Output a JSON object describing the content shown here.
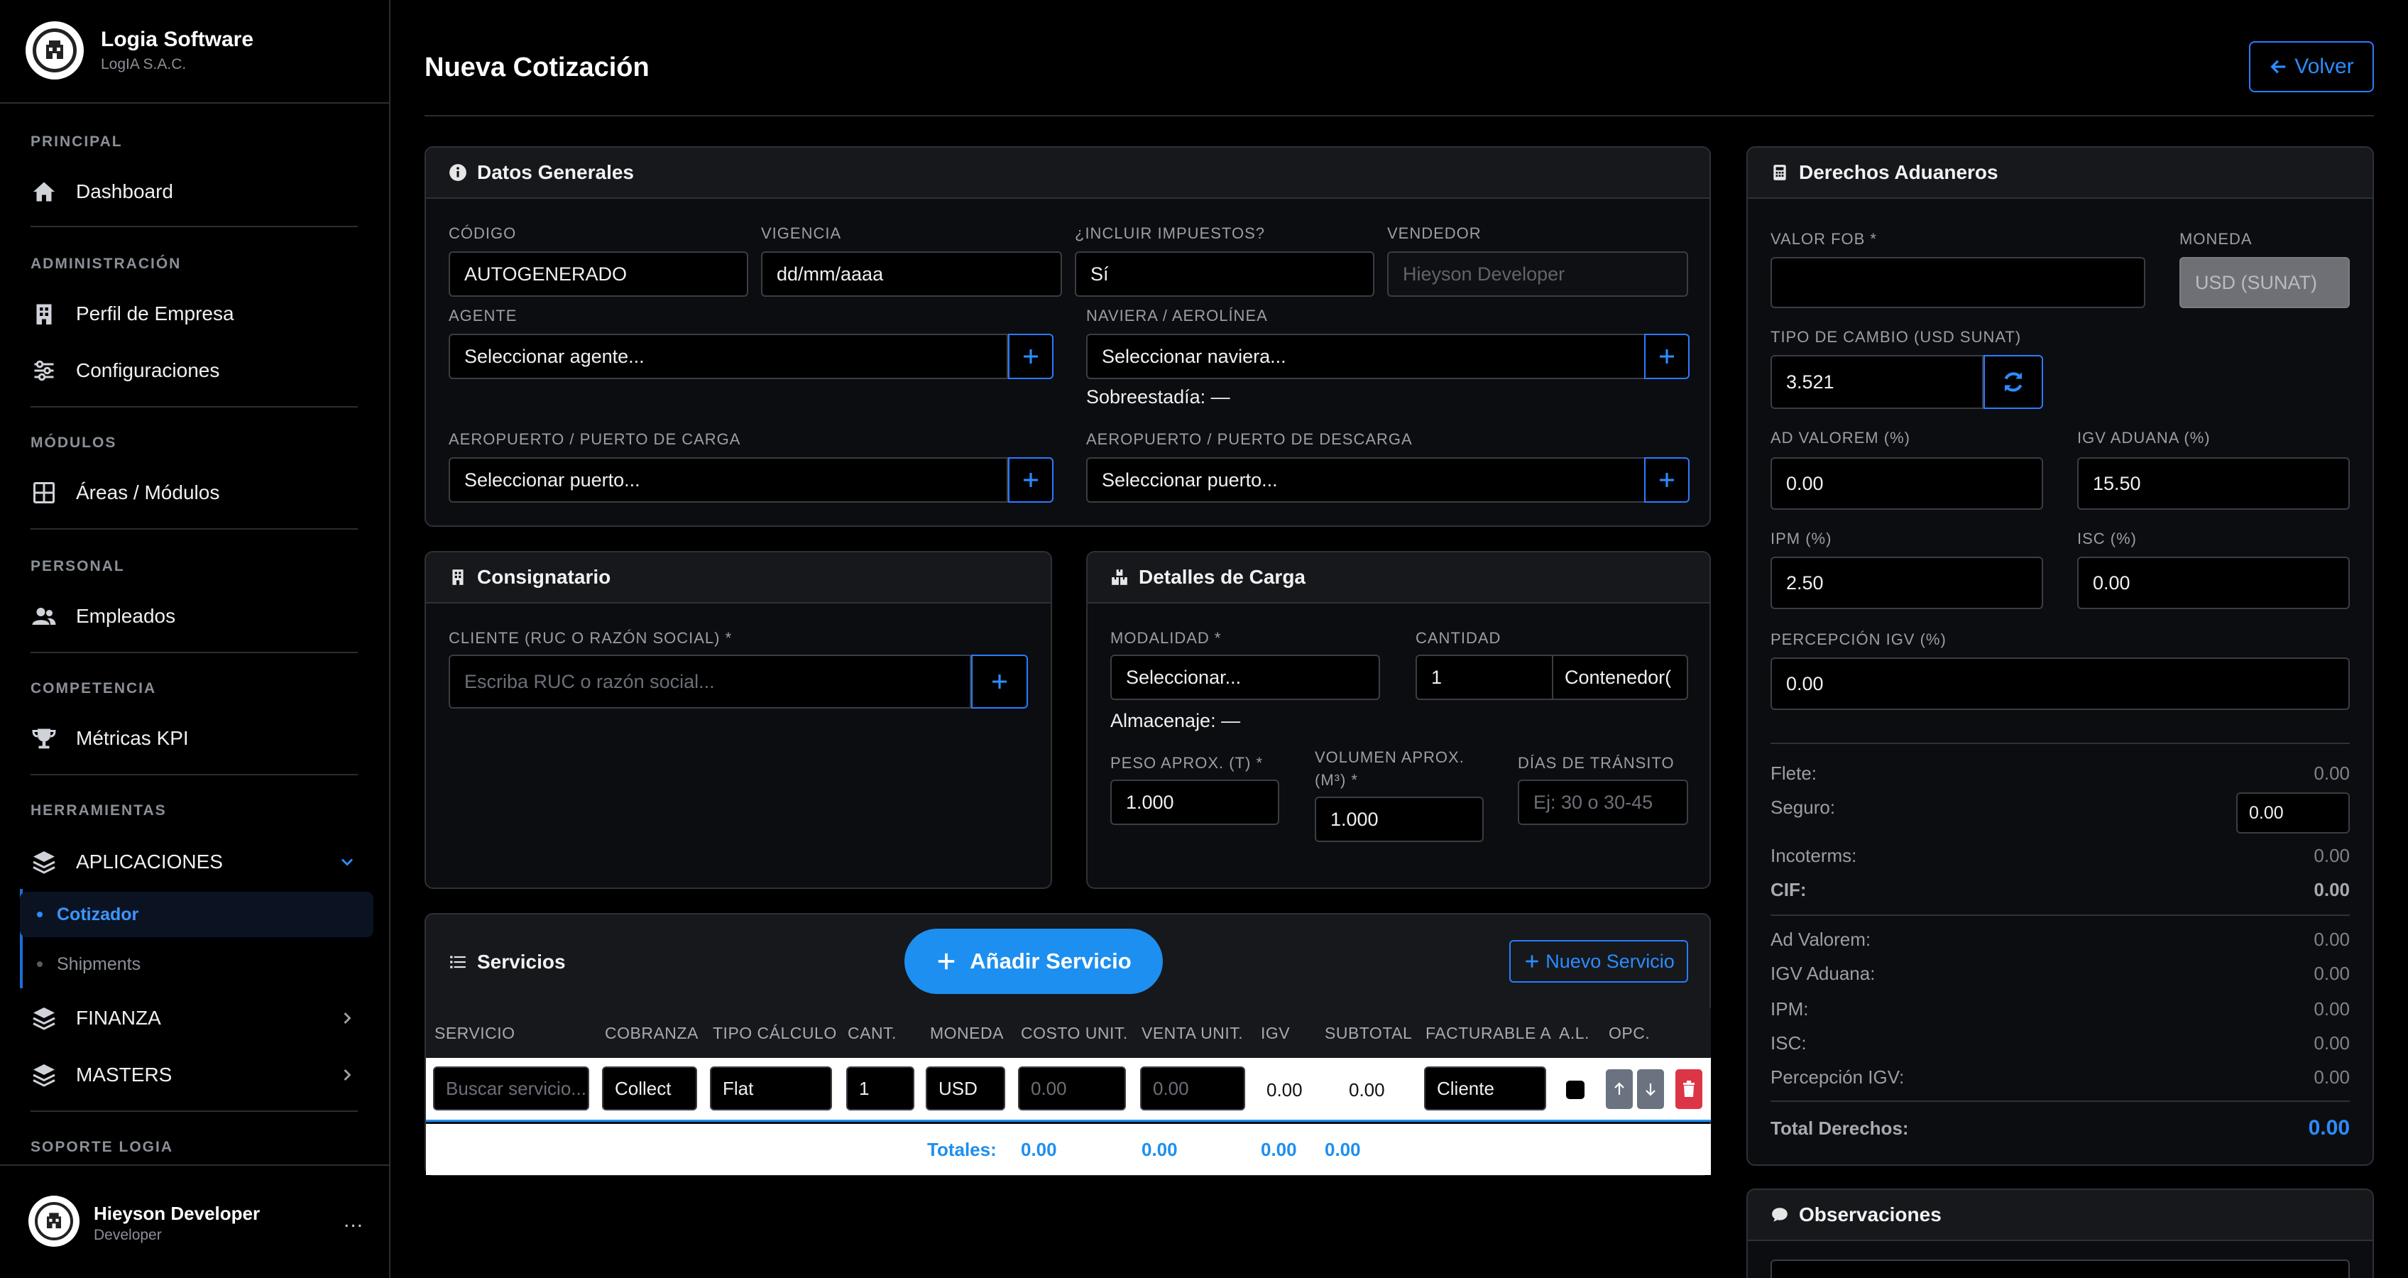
{
  "brand": {
    "name": "Logia Software",
    "sub": "LogIA S.A.C."
  },
  "sidebar": {
    "sections": {
      "principal": "PRINCIPAL",
      "administracion": "ADMINISTRACIÓN",
      "modulos": "MÓDULOS",
      "personal": "PERSONAL",
      "competencia": "COMPETENCIA",
      "herramientas": "HERRAMIENTAS",
      "soporte": "SOPORTE LOGIA"
    },
    "items": {
      "dashboard": "Dashboard",
      "perfil": "Perfil de Empresa",
      "config": "Configuraciones",
      "areas": "Áreas / Módulos",
      "empleados": "Empleados",
      "metricas": "Métricas KPI",
      "aplicaciones": "APLICACIONES",
      "cotizador": "Cotizador",
      "shipments": "Shipments",
      "finanza": "FINANZA",
      "masters": "MASTERS"
    }
  },
  "user": {
    "name": "Hieyson Developer",
    "role": "Developer",
    "more": "..."
  },
  "header": {
    "title": "Nueva Cotización",
    "back": "Volver"
  },
  "datos": {
    "title": "Datos Generales",
    "codigo_label": "CÓDIGO",
    "codigo": "AUTOGENERADO",
    "vigencia_label": "VIGENCIA",
    "vigencia": "dd/mm/aaaa",
    "impuestos_label": "¿INCLUIR IMPUESTOS?",
    "impuestos": "Sí",
    "vendedor_label": "VENDEDOR",
    "vendedor": "Hieyson Developer",
    "agente_label": "AGENTE",
    "agente": "Seleccionar agente...",
    "naviera_label": "NAVIERA / AEROLÍNEA",
    "naviera": "Seleccionar naviera...",
    "sobreestadia": "Sobreestadía: —",
    "carga_label": "AEROPUERTO / PUERTO DE CARGA",
    "carga": "Seleccionar puerto...",
    "descarga_label": "AEROPUERTO / PUERTO DE DESCARGA",
    "descarga": "Seleccionar puerto..."
  },
  "consignatario": {
    "title": "Consignatario",
    "cliente_label": "CLIENTE (RUC O RAZÓN SOCIAL) *",
    "cliente_ph": "Escriba RUC o razón social..."
  },
  "carga": {
    "title": "Detalles de Carga",
    "modalidad_label": "MODALIDAD *",
    "modalidad": "Seleccionar...",
    "cantidad_label": "CANTIDAD",
    "cantidad": "1",
    "unidad": "Contenedor(",
    "almacenaje": "Almacenaje: —",
    "peso_label": "PESO APROX. (T) *",
    "peso": "1.000",
    "volumen_label_1": "VOLUMEN APROX.",
    "volumen_label_2": "(M³) *",
    "volumen": "1.000",
    "dias_label": "DÍAS DE TRÁNSITO",
    "dias_ph": "Ej: 30 o 30-45"
  },
  "servicios": {
    "title": "Servicios",
    "add": "Añadir Servicio",
    "new": "Nuevo Servicio",
    "columns": [
      "SERVICIO",
      "COBRANZA",
      "TIPO CÁLCULO",
      "CANT.",
      "MONEDA",
      "COSTO UNIT.",
      "VENTA UNIT.",
      "IGV",
      "SUBTOTAL",
      "FACTURABLE A",
      "A.L.",
      "OPC."
    ],
    "row": {
      "servicio_ph": "Buscar servicio...",
      "cobranza": "Collect",
      "tipo": "Flat",
      "cant": "1",
      "moneda": "USD",
      "costo_ph": "0.00",
      "venta_ph": "0.00",
      "igv": "0.00",
      "subtotal": "0.00",
      "facturable": "Cliente"
    },
    "totals_label": "Totales:",
    "totals": [
      "0.00",
      "0.00",
      "0.00",
      "0.00"
    ]
  },
  "derechos": {
    "title": "Derechos Aduaneros",
    "fob_label": "VALOR FOB *",
    "moneda_label": "MONEDA",
    "moneda": "USD (SUNAT)",
    "tc_label": "TIPO DE CAMBIO (USD SUNAT)",
    "tc": "3.521",
    "advalorem_label": "AD VALOREM (%)",
    "advalorem": "0.00",
    "igv_label": "IGV ADUANA (%)",
    "igv": "15.50",
    "ipm_label": "IPM (%)",
    "ipm": "2.50",
    "isc_label": "ISC (%)",
    "isc": "0.00",
    "percepcion_label": "PERCEPCIÓN IGV (%)",
    "percepcion": "0.00",
    "summary": {
      "flete_l": "Flete:",
      "flete": "0.00",
      "seguro_l": "Seguro:",
      "seguro": "0.00",
      "incoterms_l": "Incoterms:",
      "incoterms": "0.00",
      "cif_l": "CIF:",
      "cif": "0.00",
      "adv_l": "Ad Valorem:",
      "adv": "0.00",
      "igva_l": "IGV Aduana:",
      "igva": "0.00",
      "ipm_l": "IPM:",
      "ipm": "0.00",
      "isc_l": "ISC:",
      "isc": "0.00",
      "perc_l": "Percepción IGV:",
      "perc": "0.00",
      "total_l": "Total Derechos:",
      "total": "0.00"
    }
  },
  "observaciones": {
    "title": "Observaciones"
  }
}
